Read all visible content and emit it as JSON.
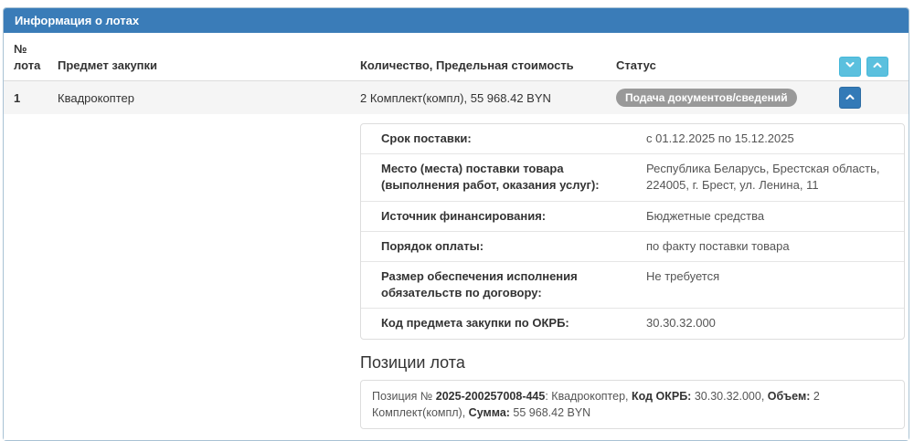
{
  "panel": {
    "title": "Информация о лотах"
  },
  "colors": {
    "header_bg": "#3A7CB8",
    "info_button_bg": "#5BC0DE",
    "primary_button_bg": "#337AB7",
    "badge_bg": "#999999",
    "panel_border": "#A9C2D4"
  },
  "icons": {
    "expand_all": "chevron-down-icon",
    "collapse_all": "chevron-up-icon",
    "lot_toggle": "chevron-up-icon"
  },
  "table": {
    "headers": {
      "lot_number": "№ лота",
      "subject": "Предмет закупки",
      "quantity": "Количество, Предельная стоимость",
      "status": "Статус"
    },
    "row": {
      "lot_number": "1",
      "subject": "Квадрокоптер",
      "quantity": "2 Комплект(компл), 55 968.42 BYN",
      "status": "Подача документов/сведений"
    }
  },
  "details": {
    "rows": [
      {
        "label": "Срок поставки:",
        "value": "с 01.12.2025 по 15.12.2025"
      },
      {
        "label": "Место (места) поставки товара (выполнения работ, оказания услуг):",
        "value": "Республика Беларусь, Брестская область, 224005, г. Брест, ул. Ленина, 11"
      },
      {
        "label": "Источник финансирования:",
        "value": "Бюджетные средства"
      },
      {
        "label": "Порядок оплаты:",
        "value": "по факту поставки товара"
      },
      {
        "label": "Размер обеспечения исполнения обязательств по договору:",
        "value": "Не требуется"
      },
      {
        "label": "Код предмета закупки по ОКРБ:",
        "value": "30.30.32.000"
      }
    ]
  },
  "positions": {
    "heading": "Позиции лота",
    "item": {
      "prefix": "Позиция № ",
      "number": "2025-200257008-445",
      "middle": ": Квадрокоптер, ",
      "okrb_label": "Код ОКРБ:",
      "okrb_value": " 30.30.32.000, ",
      "volume_label": "Объем:",
      "volume_value": " 2 Комплект(компл), ",
      "sum_label": "Сумма:",
      "sum_value": " 55 968.42 BYN"
    }
  }
}
